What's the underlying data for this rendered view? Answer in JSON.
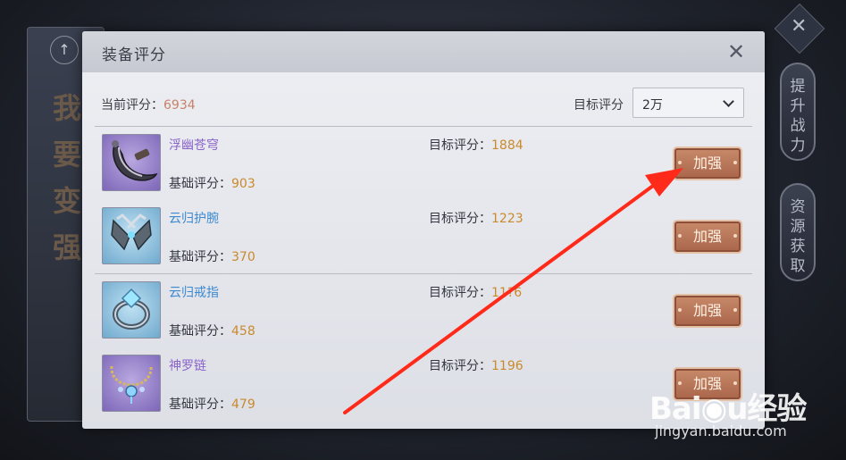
{
  "background": {
    "left_panel_text": "我要变强",
    "side_buttons": [
      {
        "label": "提升战力"
      },
      {
        "label": "资源获取"
      }
    ]
  },
  "dialog": {
    "title": "装备评分",
    "current_score_label": "当前评分：",
    "current_score_value": "6934",
    "target_score_label": "目标评分",
    "target_dropdown_value": "2万"
  },
  "items": [
    {
      "name": "浮幽苍穹",
      "base_label": "基础评分：",
      "base_value": "903",
      "target_label": "目标评分：",
      "target_value": "1884",
      "button": "加强",
      "name_color": "purple",
      "icon": "sickle-weapon-icon"
    },
    {
      "name": "云归护腕",
      "base_label": "基础评分：",
      "base_value": "370",
      "target_label": "目标评分：",
      "target_value": "1223",
      "button": "加强",
      "name_color": "blue",
      "icon": "gauntlet-icon"
    },
    {
      "name": "云归戒指",
      "base_label": "基础评分：",
      "base_value": "458",
      "target_label": "目标评分：",
      "target_value": "11?6",
      "button": "加强",
      "name_color": "blue",
      "icon": "ring-icon"
    },
    {
      "name": "神罗链",
      "base_label": "基础评分：",
      "base_value": "479",
      "target_label": "目标评分：",
      "target_value": "1196",
      "button": "加强",
      "name_color": "purple",
      "icon": "necklace-icon"
    }
  ],
  "watermark": {
    "logo": "Baidu经验",
    "url": "jingyan.baidu.com"
  },
  "colors": {
    "score_orange": "#c98a2d",
    "current_score": "#c8826a",
    "name_purple": "#8a63c9",
    "name_blue": "#3e8ad0",
    "annotation_arrow": "#ff2a1a"
  }
}
